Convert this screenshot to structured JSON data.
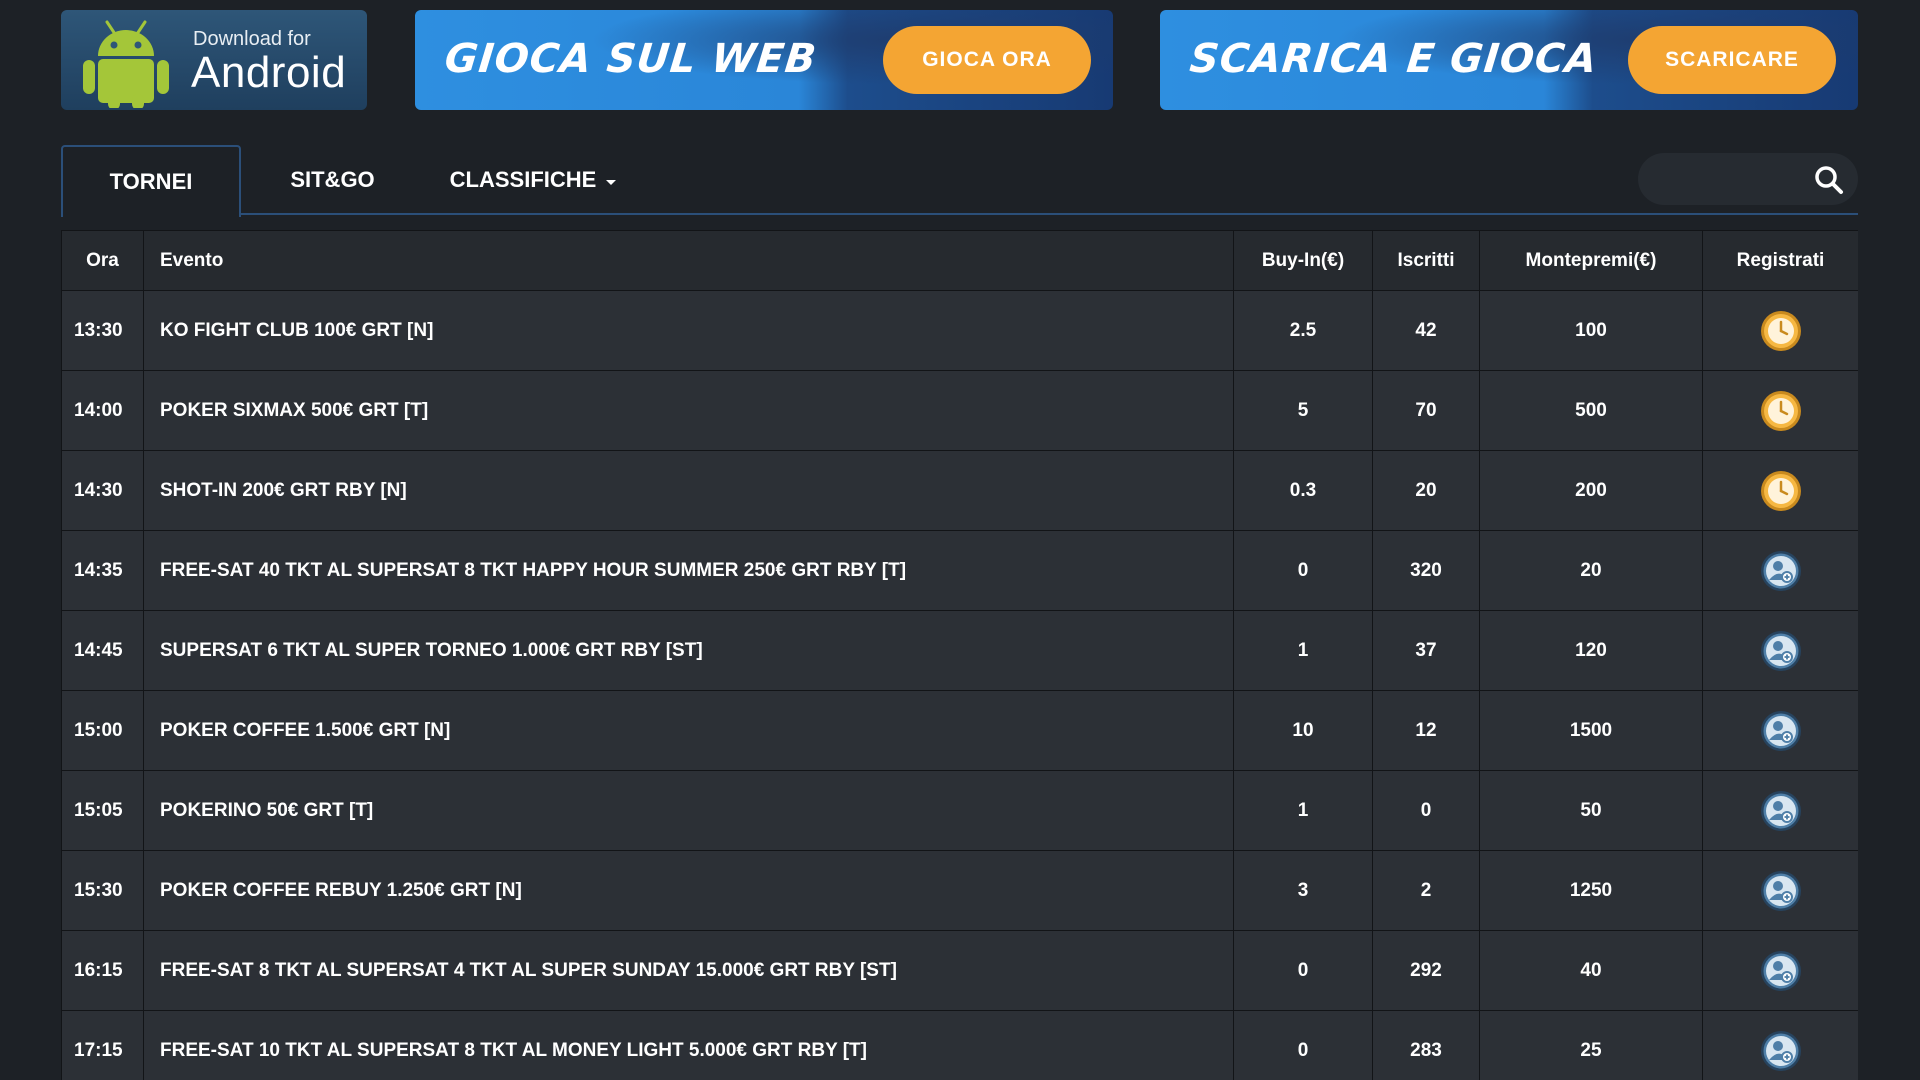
{
  "banners": {
    "android": {
      "small": "Download for",
      "big": "Android"
    },
    "web": {
      "title": "GIOCA SUL WEB",
      "button": "GIOCA ORA"
    },
    "download": {
      "title": "SCARICA E GIOCA",
      "button": "SCARICARE"
    }
  },
  "tabs": {
    "tornei": "TORNEI",
    "sitgo": "SIT&GO",
    "classifiche": "CLASSIFICHE"
  },
  "search": {
    "value": "",
    "placeholder": ""
  },
  "table": {
    "headers": {
      "ora": "Ora",
      "evento": "Evento",
      "buyin": "Buy-In(€)",
      "iscritti": "Iscritti",
      "montepremi": "Montepremi(€)",
      "registrati": "Registrati"
    },
    "rows": [
      {
        "ora": "13:30",
        "evento": "KO FIGHT CLUB 100€ GRT   [N]",
        "buyin": "2.5",
        "iscritti": "42",
        "montepremi": "100",
        "status": "clock-icon"
      },
      {
        "ora": "14:00",
        "evento": "POKER SIXMAX 500€ GRT   [T]",
        "buyin": "5",
        "iscritti": "70",
        "montepremi": "500",
        "status": "clock-icon"
      },
      {
        "ora": "14:30",
        "evento": "SHOT-IN 200€ GRT RBY   [N]",
        "buyin": "0.3",
        "iscritti": "20",
        "montepremi": "200",
        "status": "clock-icon"
      },
      {
        "ora": "14:35",
        "evento": "FREE-SAT 40 TKT AL SUPERSAT 8 TKT HAPPY HOUR SUMMER 250€ GRT RBY   [T]",
        "buyin": "0",
        "iscritti": "320",
        "montepremi": "20",
        "status": "register-user-icon"
      },
      {
        "ora": "14:45",
        "evento": "SUPERSAT 6 TKT AL SUPER TORNEO 1.000€ GRT RBY   [ST]",
        "buyin": "1",
        "iscritti": "37",
        "montepremi": "120",
        "status": "register-user-icon"
      },
      {
        "ora": "15:00",
        "evento": "POKER COFFEE 1.500€ GRT   [N]",
        "buyin": "10",
        "iscritti": "12",
        "montepremi": "1500",
        "status": "register-user-icon"
      },
      {
        "ora": "15:05",
        "evento": "POKERINO 50€ GRT   [T]",
        "buyin": "1",
        "iscritti": "0",
        "montepremi": "50",
        "status": "register-user-icon"
      },
      {
        "ora": "15:30",
        "evento": "POKER COFFEE REBUY 1.250€ GRT   [N]",
        "buyin": "3",
        "iscritti": "2",
        "montepremi": "1250",
        "status": "register-user-icon"
      },
      {
        "ora": "16:15",
        "evento": "FREE-SAT 8 TKT AL SUPERSAT 4 TKT AL SUPER SUNDAY 15.000€ GRT RBY   [ST]",
        "buyin": "0",
        "iscritti": "292",
        "montepremi": "40",
        "status": "register-user-icon"
      },
      {
        "ora": "17:15",
        "evento": "FREE-SAT 10 TKT AL SUPERSAT 8 TKT AL MONEY LIGHT 5.000€ GRT RBY   [T]",
        "buyin": "0",
        "iscritti": "283",
        "montepremi": "25",
        "status": "register-user-icon"
      }
    ]
  },
  "colors": {
    "background": "#1d2126",
    "row": "#2c3036",
    "header": "#262a2f",
    "accent_orange": "#f4a533",
    "tab_border": "#2b4f79",
    "android_green": "#a4c639",
    "register_icon": "#4f7fa8"
  }
}
